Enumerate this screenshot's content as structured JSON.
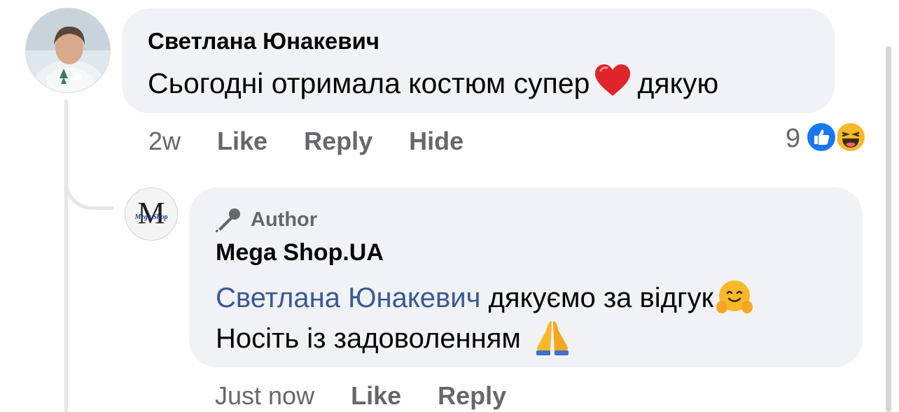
{
  "comment": {
    "author": "Светлана Юнакевич",
    "text_before": "Сьогодні отримала костюм супер",
    "text_after": "дякую",
    "time": "2w",
    "like_label": "Like",
    "reply_label": "Reply",
    "hide_label": "Hide",
    "reaction_count": "9",
    "reactions": [
      "like",
      "haha"
    ],
    "emoji": "red-heart"
  },
  "reply": {
    "badge_label": "Author",
    "author": "Mega Shop.UA",
    "mention": "Светлана Юнакевич",
    "line1_text": "дякуємо за відгук",
    "line2_text": "Носіть із задоволенням",
    "time": "Just now",
    "like_label": "Like",
    "reply_label": "Reply",
    "avatar_letter": "M",
    "avatar_brand": "Mega Shop",
    "emojis": [
      "hugging-face",
      "folded-hands"
    ]
  },
  "colors": {
    "bubble": "#f0f2f5",
    "meta_text": "#65676b",
    "mention": "#385898",
    "like_blue": "#1877f2",
    "haha_yellow": "#f7b928"
  }
}
